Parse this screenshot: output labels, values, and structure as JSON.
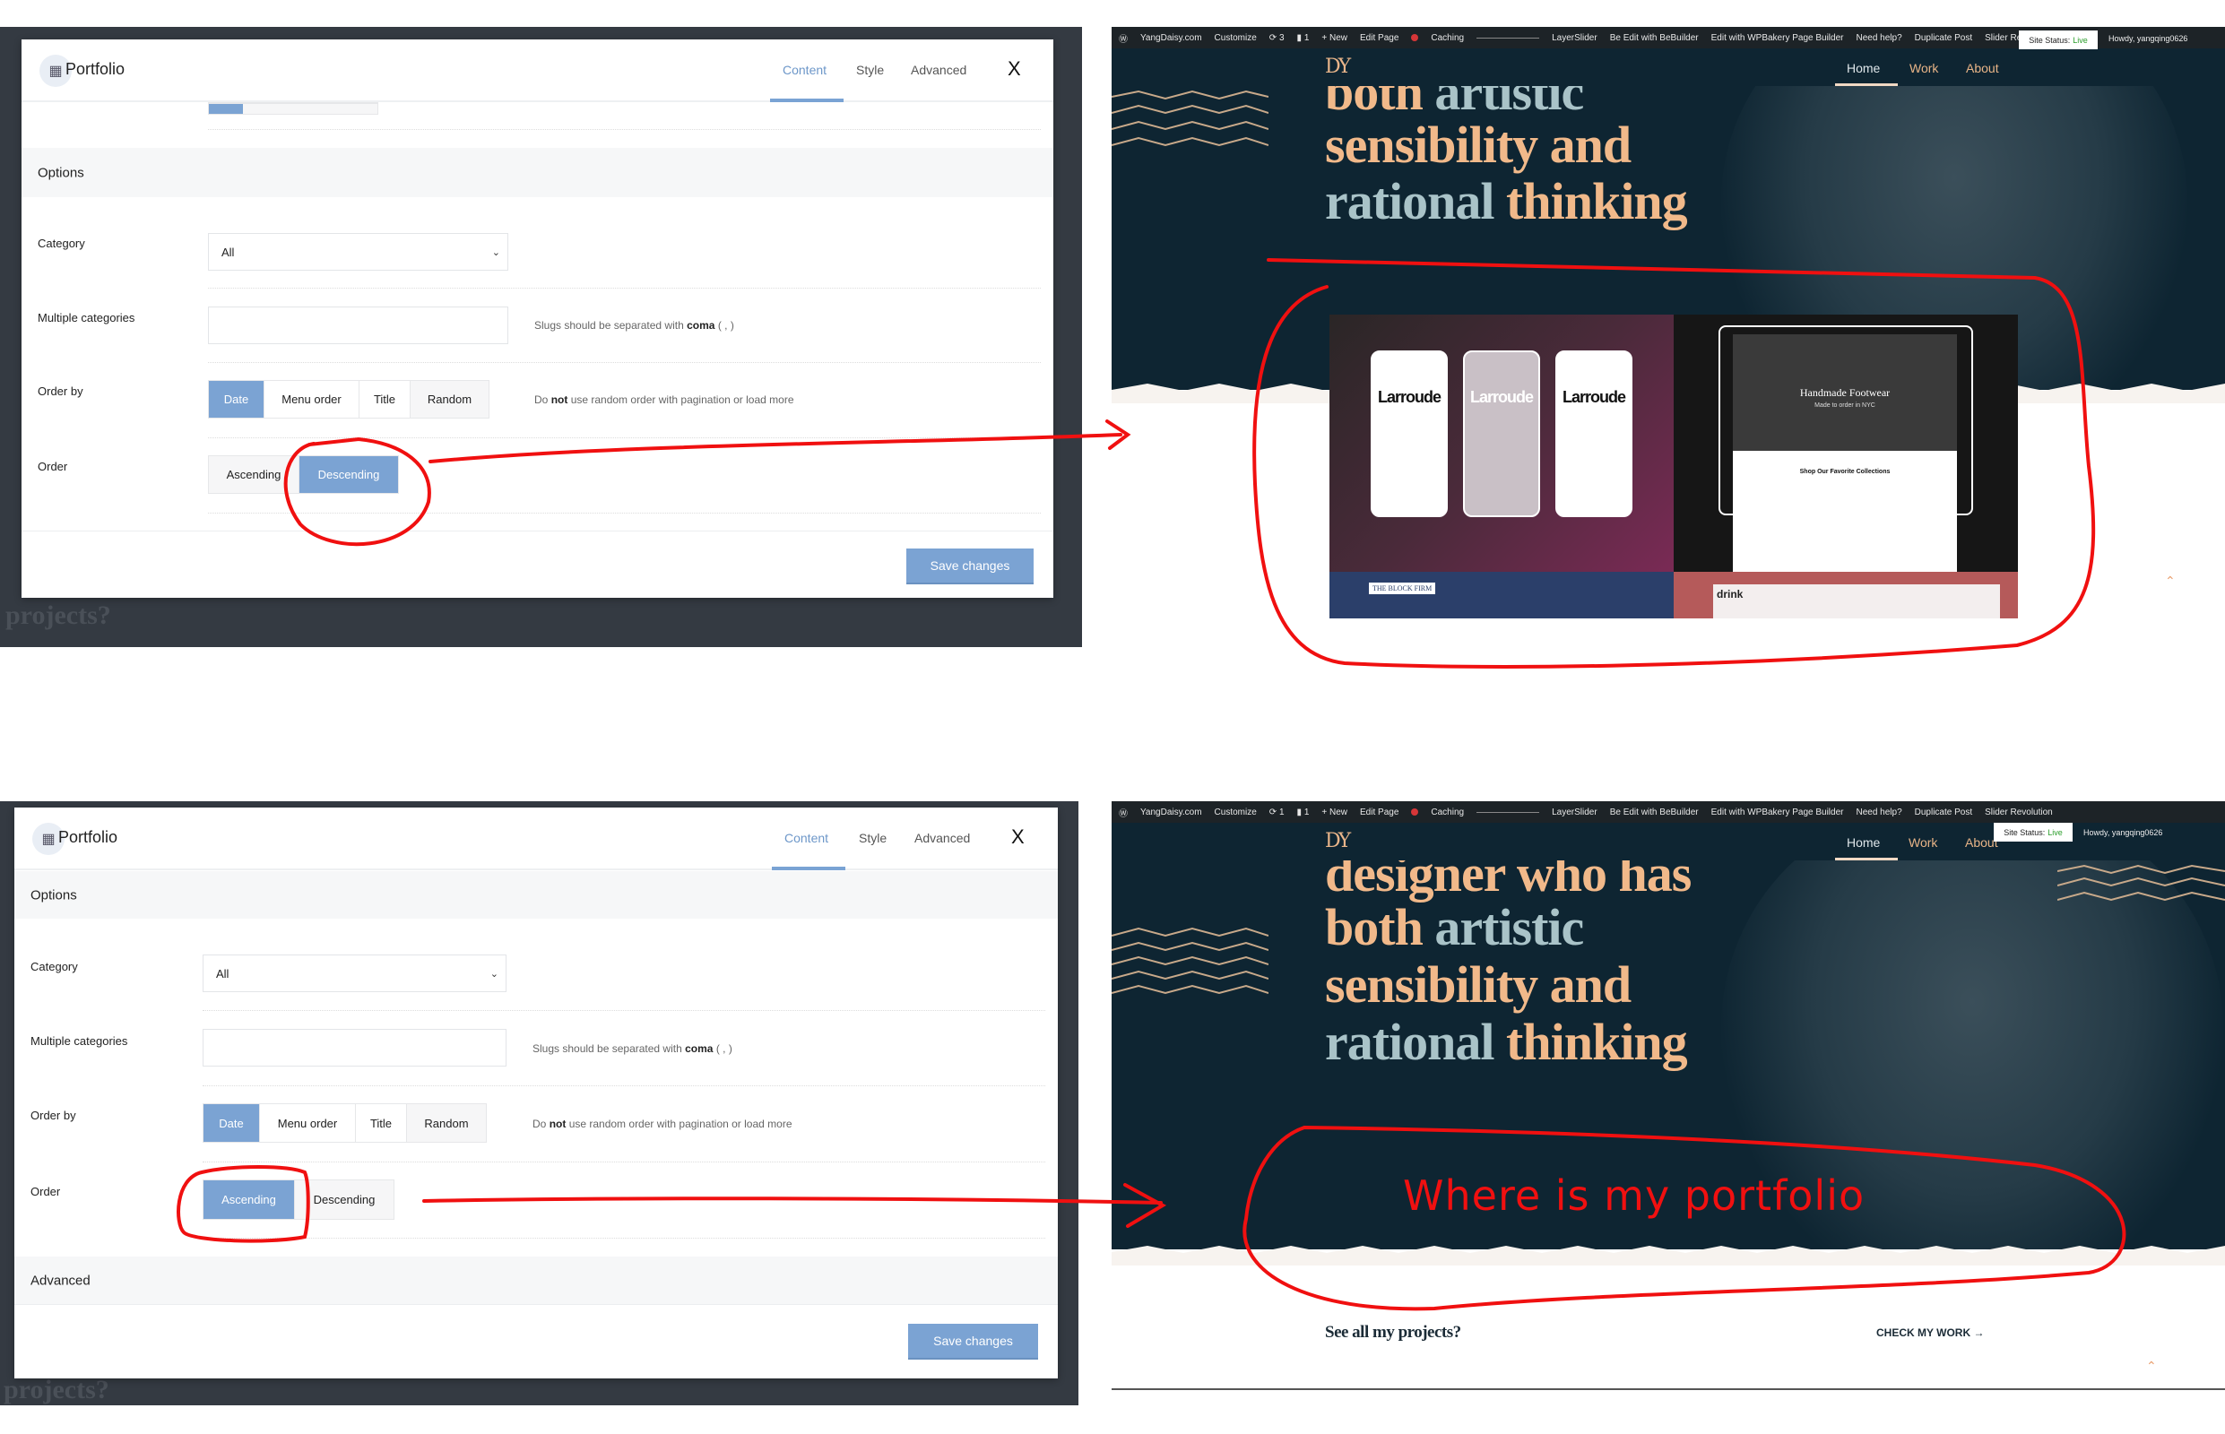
{
  "top_modal": {
    "title": "Portfolio",
    "tabs": [
      "Content",
      "Style",
      "Advanced"
    ],
    "active_tab": "Content",
    "close": "X",
    "sections": {
      "options": "Options"
    },
    "category": {
      "label": "Category",
      "value": "All"
    },
    "multiple_categories": {
      "label": "Multiple categories",
      "value": "",
      "help_prefix": "Slugs should be separated with",
      "help_bold": "coma",
      "help_suffix": "( , )"
    },
    "order_by": {
      "label": "Order by",
      "options": [
        "Date",
        "Menu order",
        "Title",
        "Random"
      ],
      "selected": "Date",
      "help_prefix": "Do",
      "help_bold": "not",
      "help_suffix": "use random order with pagination or load more"
    },
    "order": {
      "label": "Order",
      "options": [
        "Ascending",
        "Descending"
      ],
      "selected": "Descending"
    },
    "save": "Save changes",
    "backdrop_text": "projects?"
  },
  "bottom_modal": {
    "title": "Portfolio",
    "tabs": [
      "Content",
      "Style",
      "Advanced"
    ],
    "active_tab": "Content",
    "close": "X",
    "sections": {
      "options": "Options",
      "advanced": "Advanced"
    },
    "category": {
      "label": "Category",
      "value": "All"
    },
    "multiple_categories": {
      "label": "Multiple categories",
      "value": "",
      "help_prefix": "Slugs should be separated with",
      "help_bold": "coma",
      "help_suffix": "( , )"
    },
    "order_by": {
      "label": "Order by",
      "options": [
        "Date",
        "Menu order",
        "Title",
        "Random"
      ],
      "selected": "Date",
      "help_prefix": "Do",
      "help_bold": "not",
      "help_suffix": "use random order with pagination or load more"
    },
    "order": {
      "label": "Order",
      "options": [
        "Ascending",
        "Descending"
      ],
      "selected": "Ascending"
    },
    "save": "Save changes",
    "backdrop_text": "projects?"
  },
  "admin_bar_top": [
    "YangDaisy.com",
    "Customize",
    "3",
    "1",
    "New",
    "Edit Page",
    "Caching",
    "LayerSlider",
    "Be Edit with BeBuilder",
    "Edit with WPBakery Page Builder",
    "Need help?",
    "Duplicate Post",
    "Slider Revolution"
  ],
  "admin_bar_bottom": [
    "YangDaisy.com",
    "Customize",
    "1",
    "1",
    "New",
    "Edit Page",
    "Caching",
    "LayerSlider",
    "Be Edit with BeBuilder",
    "Edit with WPBakery Page Builder",
    "Need help?",
    "Duplicate Post",
    "Slider Revolution"
  ],
  "site": {
    "logo": "DY",
    "nav": [
      "Home",
      "Work",
      "About"
    ],
    "status_label": "Site Status:",
    "status_value": "Live",
    "howdy": "Howdy, yangqing0626",
    "hero_top": [
      [
        "both",
        "artistic"
      ],
      [
        "sensibility and"
      ],
      [
        "rational",
        "thinking"
      ]
    ],
    "hero_bottom": [
      [
        "designer who has"
      ],
      [
        "both",
        "artistic"
      ],
      [
        "sensibility and"
      ],
      [
        "rational",
        "thinking"
      ]
    ],
    "portfolio_tiles": {
      "larroude": "Larroude",
      "footwear_title": "Handmade Footwear",
      "footwear_sub": "Made to order in NYC",
      "footwear_collections": "Shop Our Favorite Collections",
      "block_firm": "THE BLOCK FIRM",
      "drink": "drink"
    },
    "see_all": "See all my projects?",
    "check_work": "CHECK MY WORK →"
  },
  "annotation": {
    "text": "Where is my portfolio",
    "color": "#f01010"
  },
  "colors": {
    "accent": "#7ba3d3",
    "hero_bg": "#0e2532",
    "peach": "#f1b98a",
    "blue_gray": "#a9c3c8"
  }
}
